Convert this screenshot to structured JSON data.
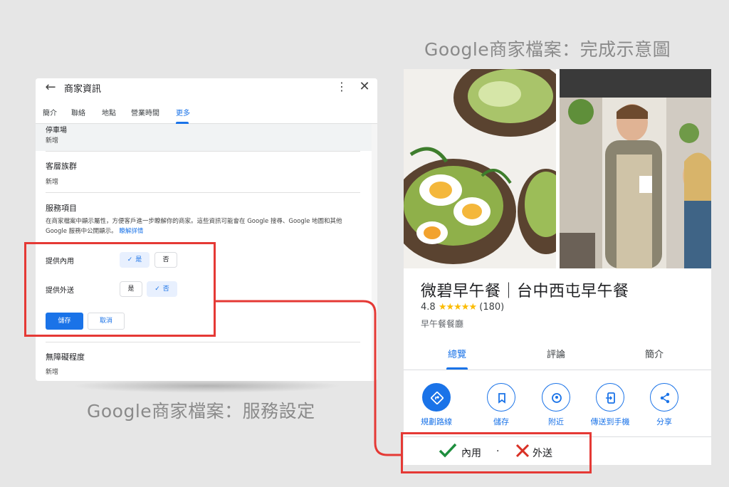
{
  "captions": {
    "right_title": "Google商家檔案：完成示意圖",
    "left_caption": "Google商家檔案：服務設定"
  },
  "panel": {
    "title": "商家資訊",
    "tabs": [
      "簡介",
      "聯絡",
      "地點",
      "營業時間",
      "更多"
    ],
    "active_tab": "更多",
    "partial_label": "停車場",
    "partial_value": "新增",
    "customer_group": {
      "label": "客層族群",
      "value": "新增"
    },
    "service_items": {
      "label": "服務項目",
      "description": "在商家檔案中顯示屬性，方便客戶進一步瞭解你的商家。這些資訊可能會在 Google 搜尋、Google 地圖和其他 Google 服務中公開顯示。",
      "learn_more": "瞭解詳情"
    },
    "dine_in": {
      "label": "提供內用",
      "yes": "是",
      "no": "否",
      "selected": "是"
    },
    "delivery": {
      "label": "提供外送",
      "yes": "是",
      "no": "否",
      "selected": "否"
    },
    "save_label": "儲存",
    "cancel_label": "取消",
    "accessibility": {
      "label": "無障礙程度",
      "value": "新增"
    }
  },
  "business": {
    "name": "微碧早午餐｜台中西屯早午餐",
    "rating": "4.8",
    "stars": "★★★★★",
    "review_count": "(180)",
    "category": "早午餐餐廳",
    "tabs": [
      "總覽",
      "評論",
      "簡介"
    ],
    "active_tab": "總覽",
    "actions": [
      {
        "label": "規劃路線",
        "icon": "directions-icon"
      },
      {
        "label": "儲存",
        "icon": "bookmark-icon"
      },
      {
        "label": "附近",
        "icon": "nearby-icon"
      },
      {
        "label": "傳送到手機",
        "icon": "send-to-phone-icon"
      },
      {
        "label": "分享",
        "icon": "share-icon"
      }
    ],
    "services": {
      "dine_in": "內用",
      "separator": "·",
      "delivery": "外送"
    }
  },
  "colors": {
    "accent": "#1a73e8",
    "highlight": "#e53935",
    "check": "#1e8e3e",
    "cross": "#d93025",
    "stars": "#fbbc04"
  }
}
